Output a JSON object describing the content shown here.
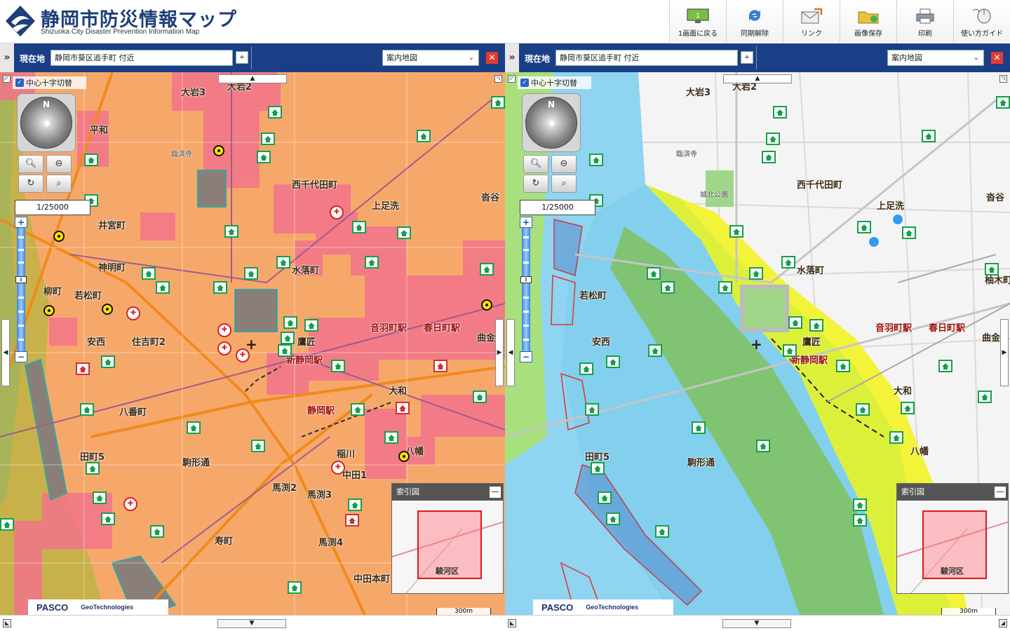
{
  "header": {
    "title": "静岡市防災情報マップ",
    "subtitle": "Shizuoka City Disaster Prevention Information Map",
    "toolbar": [
      {
        "label": "1画面に戻る",
        "icon": "single-screen-icon"
      },
      {
        "label": "同期解除",
        "icon": "sync-icon"
      },
      {
        "label": "リンク",
        "icon": "link-icon"
      },
      {
        "label": "画像保存",
        "icon": "folder-icon"
      },
      {
        "label": "印刷",
        "icon": "printer-icon"
      },
      {
        "label": "使い方ガイド",
        "icon": "mouse-icon"
      }
    ]
  },
  "left": {
    "location_label": "現在地",
    "location": "静岡市葵区追手町 付近",
    "map_type": "案内地図",
    "crosshair_label": "中心十字切替",
    "scale": "1/25000",
    "index_title": "索引図",
    "index_ward": "駿河区",
    "scale_bar": "300m",
    "credit1": "PASCO",
    "credit2": "GeoTechnologies",
    "labels": [
      {
        "t": "大岩3"
      },
      {
        "t": "大岩2"
      },
      {
        "t": "平和"
      },
      {
        "t": "臨済寺"
      },
      {
        "t": "西千代田町"
      },
      {
        "t": "上足洗"
      },
      {
        "t": "井宮町"
      },
      {
        "t": "神明町"
      },
      {
        "t": "柳町"
      },
      {
        "t": "若松町"
      },
      {
        "t": "水落町"
      },
      {
        "t": "安西"
      },
      {
        "t": "住吉町2"
      },
      {
        "t": "鷹匠"
      },
      {
        "t": "音羽町駅",
        "stn": true
      },
      {
        "t": "春日町駅",
        "stn": true
      },
      {
        "t": "新静岡駅",
        "stn": true
      },
      {
        "t": "静岡駅",
        "stn": true
      },
      {
        "t": "大和"
      },
      {
        "t": "八番町"
      },
      {
        "t": "駒形通"
      },
      {
        "t": "田町5"
      },
      {
        "t": "稲川"
      },
      {
        "t": "八幡"
      },
      {
        "t": "馬渕2"
      },
      {
        "t": "馬渕3"
      },
      {
        "t": "寿町"
      },
      {
        "t": "馬渕4"
      },
      {
        "t": "中田本町"
      },
      {
        "t": "曲金"
      },
      {
        "t": "沓谷"
      },
      {
        "t": "中田1"
      }
    ]
  },
  "right": {
    "location_label": "現在地",
    "location": "静岡市葵区追手町 付近",
    "map_type": "案内地図",
    "crosshair_label": "中心十字切替",
    "scale": "1/25000",
    "index_title": "索引図",
    "index_ward": "駿河区",
    "scale_bar": "300m",
    "credit1": "PASCO",
    "credit2": "GeoTechnologies",
    "labels": [
      {
        "t": "大岩3"
      },
      {
        "t": "大岩2"
      },
      {
        "t": "臨済寺"
      },
      {
        "t": "城北公園"
      },
      {
        "t": "西千代田町"
      },
      {
        "t": "上足洗"
      },
      {
        "t": "沓谷"
      },
      {
        "t": "若松町"
      },
      {
        "t": "水落町"
      },
      {
        "t": "安西"
      },
      {
        "t": "鷹匠"
      },
      {
        "t": "音羽町駅",
        "stn": true
      },
      {
        "t": "春日町駅",
        "stn": true
      },
      {
        "t": "新静岡駅",
        "stn": true
      },
      {
        "t": "曲金"
      },
      {
        "t": "大和"
      },
      {
        "t": "田町5"
      },
      {
        "t": "八幡"
      },
      {
        "t": "駒形通"
      },
      {
        "t": "柚木町"
      }
    ]
  }
}
